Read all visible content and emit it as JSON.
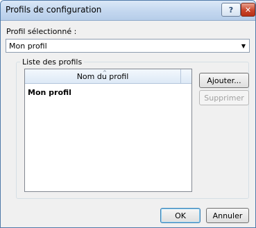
{
  "window": {
    "title": "Profils de configuration",
    "help_label": "?",
    "close_label": "✕"
  },
  "profile": {
    "label": "Profil sélectionné :",
    "selected": "Mon profil",
    "arrow": "▼"
  },
  "profiles_group": {
    "legend": "Liste des profils",
    "column_header": "Nom du profil",
    "sort_glyph": "^",
    "rows": [
      "Mon profil"
    ]
  },
  "buttons": {
    "add": "Ajouter...",
    "delete": "Supprimer",
    "ok": "OK",
    "cancel": "Annuler"
  }
}
